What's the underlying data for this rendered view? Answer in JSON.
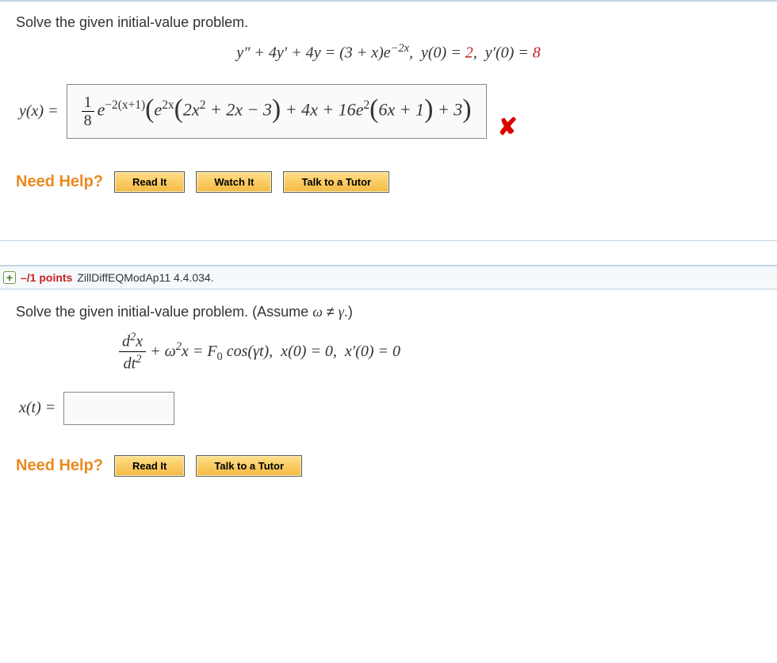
{
  "q1": {
    "prompt": "Solve the given initial-value problem.",
    "equation_html": "<span class='it'>y″</span> + 4<span class='it'>y′</span> + 4<span class='it'>y</span> = (3 + <span class='it'>x</span>)<span class='it'>e</span><sup>−2<span class='it'>x</span></sup>,&nbsp;&nbsp;<span class='it'>y</span>(0) = <span class='rhs-num'>2</span>,&nbsp;&nbsp;<span class='it'>y′</span>(0) = <span class='rhs-num'>8</span>",
    "answer_label": "y(x) = ",
    "answer_html": "<span class='frac'><span class='num'>1</span><span class='den'>8</span></span><span class='it'>e</span><sup>−2<span class='lit'>(</span><span class='it'>x</span><span class='lit'>+1)</span></sup><span class='big-paren'>(</span><span class='it'>e</span><sup>2<span class='it'>x</span></sup><span class='big-paren'>(</span>2<span class='it'>x</span><sup>2</sup> + 2<span class='it'>x</span> − 3<span class='big-paren'>)</span> + 4<span class='it'>x</span> + 16<span class='it'>e</span><sup>2</sup><span class='big-paren'>(</span>6<span class='it'>x</span> + 1<span class='big-paren'>)</span> + 3<span class='big-paren'>)</span>",
    "incorrect": "✘",
    "help": {
      "label": "Need Help?",
      "read": "Read It",
      "watch": "Watch It",
      "tutor": "Talk to a Tutor"
    }
  },
  "q2": {
    "header_points": "–/1 points",
    "header_source": "ZillDiffEQModAp11 4.4.034.",
    "prompt": "Solve the given initial-value problem. (Assume ω ≠ γ.)",
    "equation_html": "<span class='frac2'><span class='num'><span class='it'>d</span><sup>2</sup><span class='it'>x</span></span><span class='den'><span class='it'>dt</span><sup>2</sup></span></span> + <span class='it'>ω</span><sup>2</sup><span class='it'>x</span> = <span class='it'>F</span><sub>0</sub> cos(<span class='it'>γt</span>),&nbsp;&nbsp;<span class='it'>x</span>(0) = 0,&nbsp;&nbsp;<span class='it'>x′</span>(0) = 0",
    "answer_label": "x(t) = ",
    "help": {
      "label": "Need Help?",
      "read": "Read It",
      "tutor": "Talk to a Tutor"
    }
  }
}
